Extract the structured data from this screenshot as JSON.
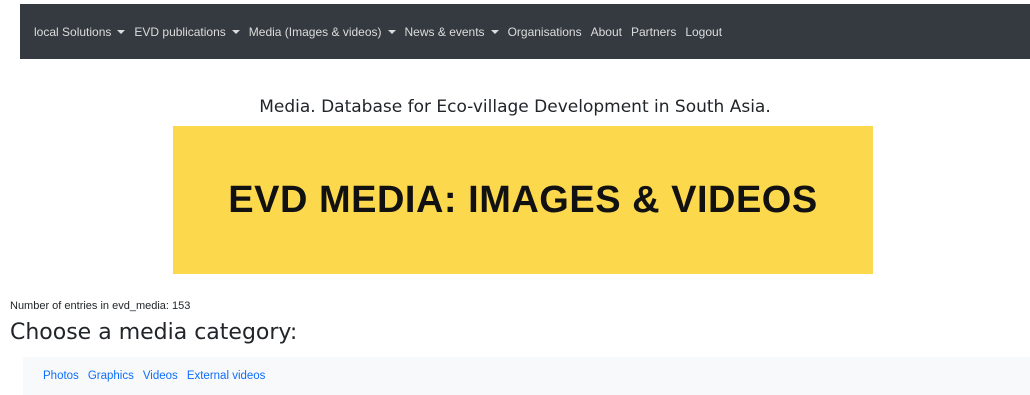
{
  "navbar": {
    "items": [
      {
        "label": "local Solutions",
        "has_dropdown": true
      },
      {
        "label": "EVD publications",
        "has_dropdown": true
      },
      {
        "label": "Media (Images & videos)",
        "has_dropdown": true
      },
      {
        "label": "News & events",
        "has_dropdown": true
      },
      {
        "label": "Organisations",
        "has_dropdown": false
      },
      {
        "label": "About",
        "has_dropdown": false
      },
      {
        "label": "Partners",
        "has_dropdown": false
      },
      {
        "label": "Logout",
        "has_dropdown": false
      }
    ],
    "background": "#343a40"
  },
  "header": {
    "title": "Media. Database for Eco-village Development in South Asia."
  },
  "banner": {
    "text": "EVD MEDIA: IMAGES & VIDEOS",
    "background": "#fcd84d"
  },
  "main": {
    "entries_text": "Number of entries in evd_media: 153",
    "section_title": "Choose a media category:",
    "categories": [
      "Photos",
      "Graphics",
      "Videos",
      "External videos"
    ]
  },
  "colors": {
    "link": "#0d6efd",
    "category_bar": "#f8f9fa"
  }
}
